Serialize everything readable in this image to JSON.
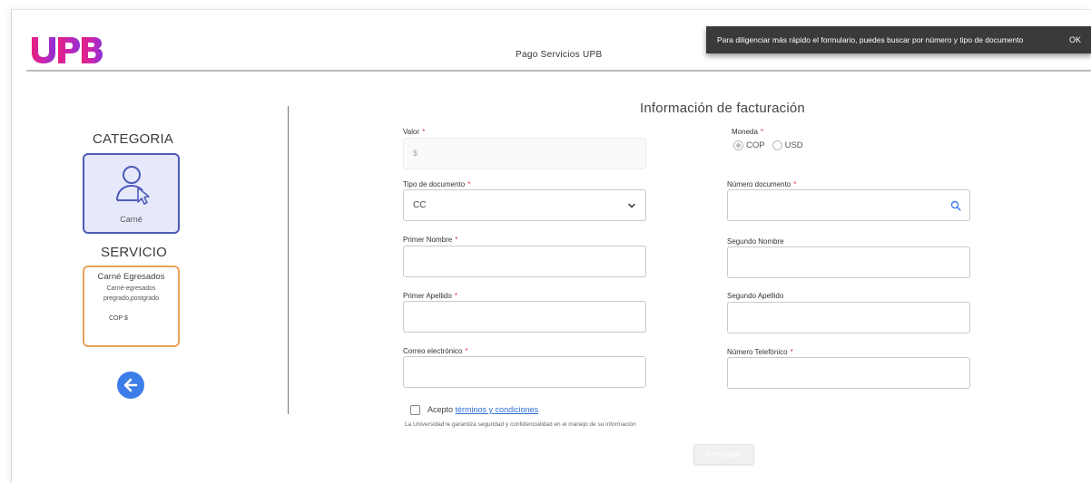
{
  "header": {
    "logo_text": "UPB",
    "title": "Pago Servicios UPB"
  },
  "toast": {
    "message": "Para diligenciar más rápido el formulario, puedes buscar por número y tipo de documento",
    "ok_label": "OK"
  },
  "sidebar": {
    "category_title": "CATEGORIA",
    "category_card": {
      "label": "Carné",
      "icon": "user-pointer-icon"
    },
    "service_title": "SERVICIO",
    "service_card": {
      "title": "Carné Egresados",
      "description": "Carné-egresados pregrado,postgrado",
      "price": "COP $"
    },
    "back_icon": "arrow-left-icon"
  },
  "form": {
    "title": "Información de facturación",
    "required_mark": "*",
    "valor": {
      "label": "Valor",
      "placeholder": "$"
    },
    "moneda": {
      "label": "Moneda",
      "options": [
        "COP",
        "USD"
      ],
      "selected": "COP"
    },
    "tipo_documento": {
      "label": "Tipo de documento",
      "value": "CC"
    },
    "numero_documento": {
      "label": "Número documento",
      "value": ""
    },
    "primer_nombre": {
      "label": "Primer Nombre",
      "value": ""
    },
    "segundo_nombre": {
      "label": "Segundo Nombre",
      "value": ""
    },
    "primer_apellido": {
      "label": "Primer Apellido",
      "value": ""
    },
    "segundo_apellido": {
      "label": "Segundo Apellido",
      "value": ""
    },
    "correo": {
      "label": "Correo electrónico",
      "value": ""
    },
    "telefono": {
      "label": "Número Telefónico",
      "value": ""
    },
    "accept_prefix": "Acepto",
    "accept_link": "términos y condiciones",
    "privacy_note": "La Universidad le garantiza seguridad y confidencialidad en el manejo de su información",
    "continue_label": "Continuar"
  },
  "colors": {
    "brand_magenta": "#e21f8c",
    "brand_purple": "#a22ad0",
    "category_border": "#4d5bb8",
    "service_border": "#e9a15a",
    "back_button": "#3d7de8",
    "required": "#d9363e",
    "link": "#2c6fd6"
  }
}
